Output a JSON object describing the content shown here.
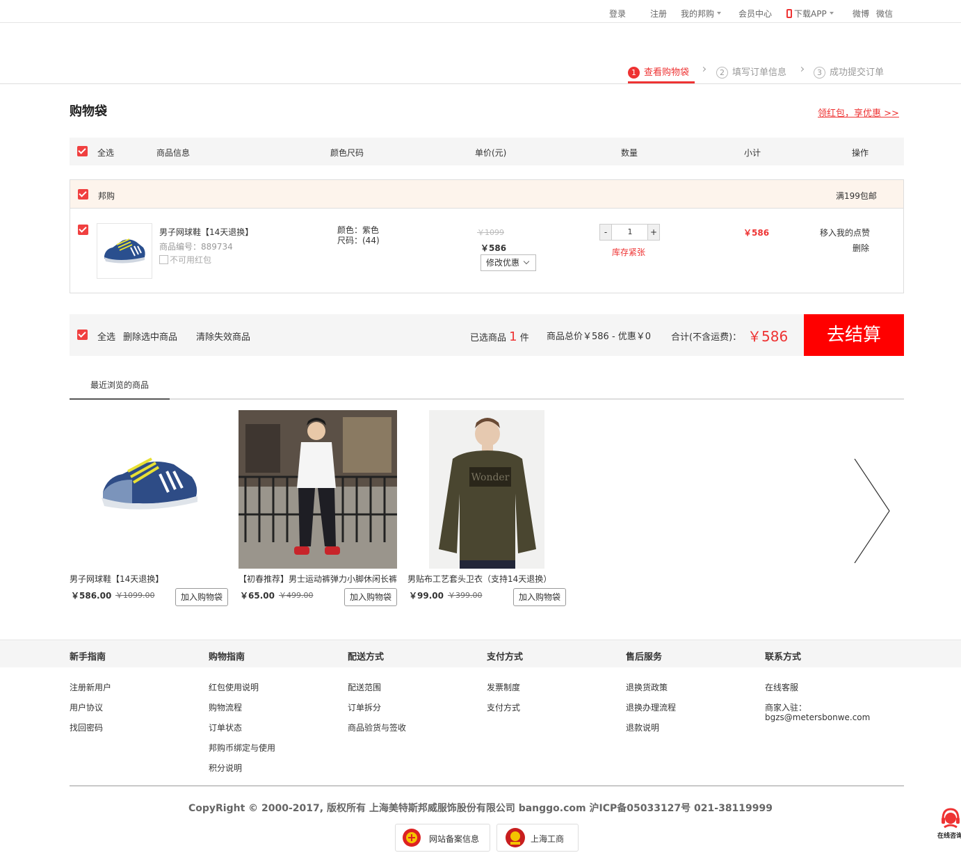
{
  "topbar": {
    "login": "登录",
    "register": "注册",
    "my_banggo": "我的邦购",
    "member_center": "会员中心",
    "download_app": "下载APP",
    "weibo": "微博",
    "weixin": "微信"
  },
  "steps": [
    {
      "num": "1",
      "label": "查看购物袋"
    },
    {
      "num": "2",
      "label": "填写订单信息"
    },
    {
      "num": "3",
      "label": "成功提交订单"
    }
  ],
  "cart": {
    "title": "购物袋",
    "promo_link": "领红包，享优惠 >>",
    "columns": {
      "select_all": "全选",
      "product_info": "商品信息",
      "color_size": "颜色尺码",
      "unit_price": "单价(元)",
      "quantity": "数量",
      "subtotal": "小计",
      "action": "操作"
    },
    "shop": {
      "name": "邦购",
      "shipping_note": "满199包邮"
    },
    "item": {
      "name": "男子网球鞋【14天退换】",
      "code": "商品编号：889734",
      "no_coupon": "不可用红包",
      "color": "颜色：紫色",
      "size": "尺码：(44)",
      "original_price": "￥1099",
      "price": "￥586",
      "modify_offer": "修改优惠",
      "qty_minus": "-",
      "qty_value": "1",
      "qty_plus": "+",
      "stock_note": "库存紧张",
      "subtotal": "￥586",
      "move_to_fav": "移入我的点赞",
      "delete": "删除"
    },
    "summary": {
      "select_all": "全选",
      "delete_selected": "删除选中商品",
      "clear_invalid": "清除失效商品",
      "selected_prefix": "已选商品",
      "selected_count": "1",
      "selected_suffix": "件",
      "totals": "商品总价￥586 - 优惠￥0",
      "total_label": "合计(不含运费)：",
      "total_value": "￥586",
      "checkout": "去结算"
    }
  },
  "recent": {
    "tab": "最近浏览的商品",
    "items": [
      {
        "name": "男子网球鞋【14天退换】",
        "price": "￥586.00",
        "old_price": "￥1099.00",
        "add": "加入购物袋"
      },
      {
        "name": "【初春推荐】男士运动裤弹力小脚休闲长裤",
        "price": "￥65.00",
        "old_price": "￥499.00",
        "add": "加入购物袋"
      },
      {
        "name": "男贴布工艺套头卫衣（支持14天退换）",
        "price": "￥99.00",
        "old_price": "￥399.00",
        "add": "加入购物袋"
      }
    ],
    "sweater_text": "Wonder"
  },
  "footer": {
    "columns": [
      {
        "title": "新手指南",
        "links": [
          "注册新用户",
          "用户协议",
          "找回密码"
        ]
      },
      {
        "title": "购物指南",
        "links": [
          "红包使用说明",
          "购物流程",
          "订单状态",
          "邦购币绑定与使用",
          "积分说明"
        ]
      },
      {
        "title": "配送方式",
        "links": [
          "配送范围",
          "订单拆分",
          "商品验货与签收"
        ]
      },
      {
        "title": "支付方式",
        "links": [
          "发票制度",
          "支付方式"
        ]
      },
      {
        "title": "售后服务",
        "links": [
          "退换货政策",
          "退换办理流程",
          "退款说明"
        ]
      },
      {
        "title": "联系方式",
        "links": [
          "在线客服",
          "商家入驻：",
          "bgzs@metersbonwe.com"
        ]
      }
    ],
    "copyright": "CopyRight © 2000-2017, 版权所有 上海美特斯邦威服饰股份有限公司 banggo.com 沪ICP备05033127号 021-38119999",
    "badge_1": "网站备案信息",
    "badge_2": "上海工商",
    "online": "在线咨询"
  },
  "colors": {
    "accent": "#e33333",
    "checkout": "#ff0000",
    "shop_header_bg": "#fdf4ec"
  }
}
